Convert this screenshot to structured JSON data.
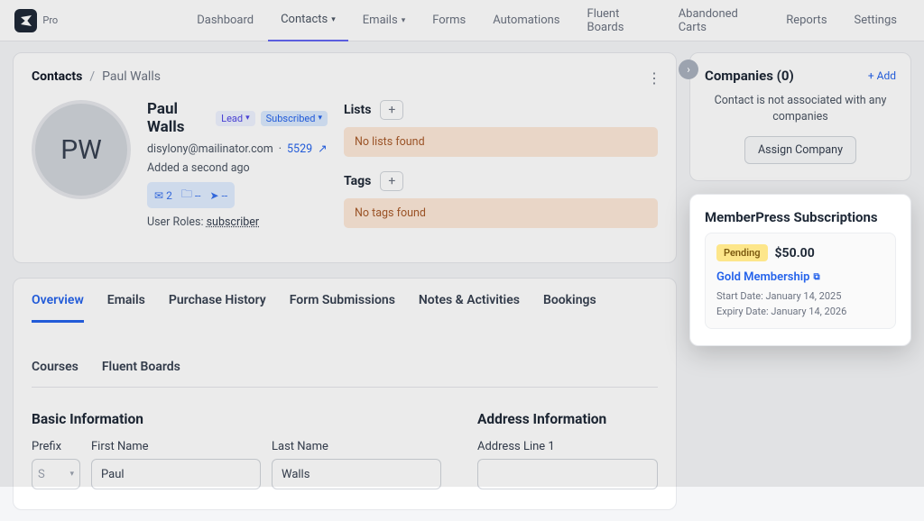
{
  "brand": {
    "badge": "Pro"
  },
  "nav": {
    "items": [
      {
        "label": "Dashboard"
      },
      {
        "label": "Contacts",
        "caret": true,
        "active": true
      },
      {
        "label": "Emails",
        "caret": true
      },
      {
        "label": "Forms"
      },
      {
        "label": "Automations"
      },
      {
        "label": "Fluent Boards"
      },
      {
        "label": "Abandoned Carts"
      },
      {
        "label": "Reports"
      },
      {
        "label": "Settings"
      }
    ]
  },
  "breadcrumb": {
    "root": "Contacts",
    "leaf": "Paul Walls"
  },
  "contact": {
    "initials": "PW",
    "name": "Paul Walls",
    "lead_pill": "Lead",
    "sub_pill": "Subscribed",
    "email": "disylony@mailinator.com",
    "cid": "5529",
    "added": "Added a second ago",
    "stat_mail": "2",
    "stat_folder": "--",
    "stat_send": "--",
    "roles_label": "User Roles:",
    "roles_value": "subscriber"
  },
  "lists": {
    "label": "Lists",
    "empty": "No lists found"
  },
  "tags": {
    "label": "Tags",
    "empty": "No tags found"
  },
  "tabs": [
    {
      "label": "Overview",
      "active": true
    },
    {
      "label": "Emails"
    },
    {
      "label": "Purchase History"
    },
    {
      "label": "Form Submissions"
    },
    {
      "label": "Notes & Activities"
    },
    {
      "label": "Bookings"
    },
    {
      "label": "Courses"
    },
    {
      "label": "Fluent Boards"
    }
  ],
  "basic": {
    "title": "Basic Information",
    "prefix_label": "Prefix",
    "prefix_value": "S",
    "first_label": "First Name",
    "first_value": "Paul",
    "last_label": "Last Name",
    "last_value": "Walls"
  },
  "address": {
    "title": "Address Information",
    "line1_label": "Address Line 1",
    "line1_value": ""
  },
  "companies": {
    "title": "Companies (0)",
    "add": "+ Add",
    "empty": "Contact is not associated with any companies",
    "assign": "Assign Company"
  },
  "memberpress": {
    "title": "MemberPress Subscriptions",
    "status": "Pending",
    "price": "$50.00",
    "plan": "Gold Membership",
    "start": "Start Date: January 14, 2025",
    "expiry": "Expiry Date: January 14, 2026"
  }
}
